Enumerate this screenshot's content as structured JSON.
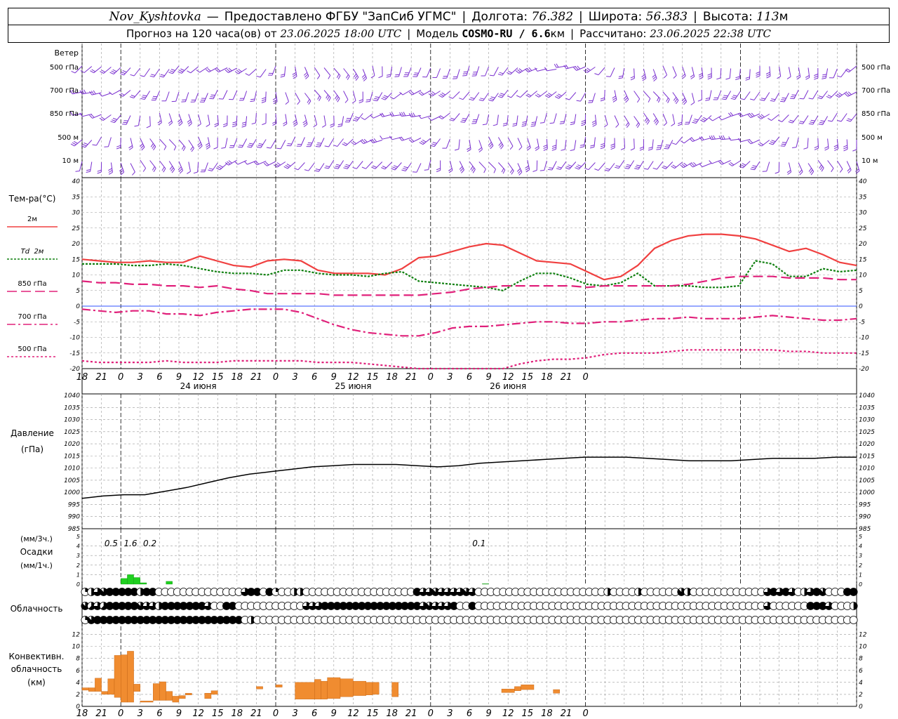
{
  "header": {
    "station": "Nov_Kyshtovka",
    "dash": "—",
    "provider": "Предоставлено ФГБУ \"ЗапСиб УГМС\"",
    "lon_label": "Долгота:",
    "lon": "76.382",
    "lat_label": "Широта:",
    "lat": "56.383",
    "alt_label": "Высота:",
    "alt": "113",
    "alt_unit": "м",
    "forecast_label": "Прогноз на 120 часа(ов) от",
    "forecast_from": "23.06.2025 18:00 UTC",
    "model_label": "Модель",
    "model": "COSMO-RU / 6.6",
    "model_unit": "км",
    "calc_label": "Рассчитано:",
    "calc_time": "23.06.2025 22:38 UTC"
  },
  "labels": {
    "wind": "Ветер",
    "levels": [
      "500 гПа",
      "700 гПа",
      "850 гПа",
      "500 м",
      "10 м"
    ],
    "temp_title": "Тем-ра(°C)",
    "temp_legend": [
      {
        "label": "2м",
        "color": "#f04040"
      },
      {
        "label": "Td  2м",
        "color": "#108010"
      },
      {
        "label": "850 гПа",
        "color": "#e0207a"
      },
      {
        "label": "700 гПа",
        "color": "#e0207a"
      },
      {
        "label": "500 гПа",
        "color": "#e0207a"
      }
    ],
    "pressure_title_1": "Давление",
    "pressure_title_2": "(гПа)",
    "precip_title_1": "(мм/3ч.)",
    "precip_title_2": "Осадки",
    "precip_title_3": "(мм/1ч.)",
    "cloud_title": "Облачность",
    "conv_title_1": "Конвективн.",
    "conv_title_2": "облачность",
    "conv_title_3": "(км)"
  },
  "chart_data": {
    "type": "line",
    "time_axis": {
      "hour_labels": [
        "18",
        "21",
        "0",
        "3",
        "6",
        "9",
        "12",
        "15",
        "18",
        "21",
        "0",
        "3",
        "6",
        "9",
        "12",
        "15",
        "18",
        "21",
        "0",
        "3",
        "6",
        "9",
        "12",
        "15",
        "18",
        "21",
        "0"
      ],
      "day_labels": [
        "24 июня",
        "25 июня",
        "26 июня"
      ]
    },
    "temperature": {
      "ylim": [
        -20,
        40
      ],
      "ticks": [
        -20,
        -15,
        -10,
        -5,
        0,
        5,
        10,
        15,
        20,
        25,
        30,
        35,
        40
      ],
      "hours": [
        0,
        3,
        6,
        9,
        12,
        15,
        18,
        21,
        24,
        27,
        30,
        33,
        36,
        39,
        42,
        45,
        48,
        51,
        54,
        57,
        60,
        63,
        66,
        69,
        72,
        75,
        78,
        81,
        84,
        87,
        90,
        93,
        96,
        99,
        102,
        105,
        108,
        111,
        114,
        117,
        120
      ],
      "series": [
        {
          "name": "2м",
          "color": "#f04040",
          "dash": "",
          "values": [
            15,
            14.5,
            14,
            14,
            14.5,
            14,
            14,
            16,
            14.5,
            13,
            12.5,
            14.5,
            15,
            14.5,
            11.5,
            10.5,
            10.5,
            10.5,
            10,
            12,
            15.5,
            16,
            17.5,
            19,
            20,
            19.5,
            17,
            14.5,
            14,
            13.5,
            11,
            8.5,
            9.5,
            13,
            18.5,
            21,
            22.5,
            23,
            23,
            22.5,
            21.5,
            19.5,
            17.5,
            18.5,
            16.5,
            14,
            13
          ]
        },
        {
          "name": "Td  2м",
          "color": "#108010",
          "dash": "3,2",
          "values": [
            13.5,
            13.5,
            13.5,
            13,
            13,
            13.5,
            13,
            12,
            11,
            10.5,
            10.5,
            10,
            11.5,
            11.5,
            10.5,
            10,
            10,
            9.5,
            10.5,
            11,
            8,
            7.5,
            7,
            6.5,
            6,
            5,
            8,
            10.5,
            10.5,
            9,
            7,
            6.5,
            7.5,
            10.5,
            6.5,
            6.5,
            6.5,
            6,
            6,
            6.5,
            14.5,
            13.5,
            9.5,
            9.5,
            12,
            11,
            11.5
          ]
        },
        {
          "name": "850 гПа",
          "color": "#e0207a",
          "dash": "14,6",
          "values": [
            8,
            7.5,
            7.5,
            7,
            7,
            6.5,
            6.5,
            6,
            6.5,
            5.5,
            5,
            4,
            4,
            4,
            4,
            3.5,
            3.5,
            3.5,
            3.5,
            3.5,
            3.5,
            4,
            4.5,
            5.5,
            6,
            6.5,
            6.5,
            6.5,
            6.5,
            6.5,
            6,
            6.5,
            6.5,
            6.5,
            6.5,
            6.5,
            7,
            8,
            9,
            9.5,
            9.5,
            9.5,
            9,
            9,
            9,
            8.5,
            8.5
          ]
        },
        {
          "name": "700 гПа",
          "color": "#e0207a",
          "dash": "12,4,3,4",
          "values": [
            -1,
            -1.5,
            -2,
            -1.5,
            -1.5,
            -2.5,
            -2.5,
            -3,
            -2,
            -1.5,
            -1,
            -1,
            -1,
            -2,
            -4,
            -6,
            -7.5,
            -8.5,
            -9,
            -9.5,
            -9.5,
            -8.5,
            -7,
            -6.5,
            -6.5,
            -6,
            -5.5,
            -5,
            -5,
            -5.5,
            -5.5,
            -5,
            -5,
            -4.5,
            -4,
            -4,
            -3.5,
            -4,
            -4,
            -4,
            -3.5,
            -3,
            -3.5,
            -4,
            -4.5,
            -4.5,
            -4
          ]
        },
        {
          "name": "500 гПа",
          "color": "#e0207a",
          "dash": "3,3",
          "values": [
            -17.5,
            -18,
            -18,
            -18,
            -18,
            -17.5,
            -18,
            -18,
            -18,
            -17.5,
            -17.5,
            -17.5,
            -17.5,
            -17.5,
            -18,
            -18,
            -18,
            -18.5,
            -19,
            -19.5,
            -20,
            -20,
            -20,
            -20,
            -20,
            -20,
            -18.5,
            -17.5,
            -17,
            -17,
            -16.5,
            -15.5,
            -15,
            -15,
            -15,
            -14.5,
            -14,
            -14,
            -14,
            -14,
            -14,
            -14,
            -14.5,
            -14.5,
            -15,
            -15,
            -15
          ]
        }
      ]
    },
    "pressure": {
      "ylim": [
        985,
        1040
      ],
      "ticks": [
        985,
        990,
        995,
        1000,
        1005,
        1010,
        1015,
        1020,
        1025,
        1030,
        1035,
        1040
      ],
      "values": [
        997.5,
        998.5,
        999,
        999,
        1000.5,
        1002,
        1004,
        1006,
        1007.5,
        1008.5,
        1009.5,
        1010.5,
        1011,
        1011.5,
        1011.5,
        1011.5,
        1011,
        1010.5,
        1011,
        1012,
        1012.5,
        1013,
        1013.5,
        1014,
        1014.5,
        1014.5,
        1014.5,
        1014,
        1013.5,
        1013,
        1013,
        1013,
        1013.5,
        1014,
        1014,
        1014,
        1014.5,
        1014.5
      ]
    },
    "precipitation": {
      "ylim": [
        0,
        5
      ],
      "ticks": [
        0,
        1,
        2,
        3,
        4,
        5
      ],
      "labels": [
        {
          "hour": 6,
          "text": "0.5"
        },
        {
          "hour": 9,
          "text": "1.6"
        },
        {
          "hour": 12,
          "text": "0.2"
        },
        {
          "hour": 63,
          "text": "0.1"
        }
      ],
      "hourly": [
        {
          "hour": 6,
          "value": 0.6
        },
        {
          "hour": 7,
          "value": 1.0
        },
        {
          "hour": 8,
          "value": 0.7
        },
        {
          "hour": 9,
          "value": 0.15
        },
        {
          "hour": 13,
          "value": 0.3
        },
        {
          "hour": 62,
          "value": 0.05
        }
      ]
    },
    "cloud_cover": {
      "scale": "octas 0-8",
      "rows": [
        [
          2,
          4,
          6,
          7,
          8,
          8,
          8,
          8,
          8,
          4,
          8,
          8,
          0,
          0,
          0,
          0,
          0,
          0,
          0,
          0,
          0,
          0,
          0,
          0,
          0,
          0,
          6,
          8,
          8,
          0,
          8,
          2,
          0,
          0,
          4,
          4,
          0,
          0,
          0,
          0,
          0,
          0,
          0,
          0,
          0,
          0,
          0,
          0,
          0,
          0,
          0,
          0,
          0,
          0,
          8,
          6,
          6,
          7,
          6,
          6,
          6,
          6,
          7,
          6,
          0,
          0,
          0,
          0,
          0,
          0,
          0,
          0,
          0,
          0,
          0,
          0,
          0,
          0,
          0,
          0,
          0,
          0,
          0,
          0,
          0,
          4,
          0,
          0,
          0,
          0,
          4,
          0,
          0,
          0,
          0,
          0,
          0,
          7,
          4,
          0,
          0,
          0,
          0,
          0,
          0,
          0,
          0,
          0,
          0,
          0,
          0,
          6,
          8,
          6,
          8,
          6,
          0,
          4,
          6,
          8,
          7,
          0,
          0,
          0,
          8,
          8
        ],
        [
          7,
          5,
          6,
          5,
          8,
          8,
          8,
          8,
          8,
          7,
          6,
          6,
          4,
          8,
          8,
          8,
          8,
          8,
          8,
          8,
          6,
          0,
          0,
          8,
          8,
          0,
          0,
          0,
          0,
          0,
          0,
          0,
          0,
          0,
          0,
          0,
          6,
          6,
          6,
          8,
          8,
          8,
          8,
          8,
          8,
          8,
          8,
          8,
          8,
          8,
          8,
          8,
          8,
          8,
          8,
          6,
          7,
          6,
          6,
          6,
          8,
          0,
          0,
          8,
          0,
          0,
          0,
          0,
          0,
          0,
          0,
          0,
          0,
          0,
          0,
          0,
          0,
          0,
          0,
          0,
          0,
          0,
          0,
          0,
          0,
          0,
          0,
          0,
          0,
          0,
          0,
          0,
          0,
          0,
          0,
          0,
          0,
          0,
          0,
          0,
          0,
          0,
          0,
          0,
          0,
          0,
          0,
          0,
          0,
          0,
          0,
          6,
          0,
          0,
          0,
          0,
          0,
          0,
          8,
          8,
          8,
          6,
          0,
          0,
          0,
          4
        ],
        [
          2,
          7,
          8,
          8,
          8,
          8,
          8,
          8,
          8,
          8,
          8,
          8,
          8,
          8,
          8,
          8,
          8,
          8,
          8,
          8,
          8,
          8,
          8,
          8,
          8,
          8,
          0,
          4,
          0,
          0,
          0,
          0,
          0,
          0,
          0,
          0,
          0,
          0,
          0,
          0,
          0,
          0,
          0,
          0,
          0,
          0,
          0,
          0,
          0,
          0,
          0,
          0,
          0,
          0,
          0,
          0,
          0,
          0,
          0,
          0,
          0,
          0,
          0,
          0,
          0,
          0,
          0,
          0,
          0,
          0,
          0,
          0,
          0,
          0,
          0,
          0,
          0,
          0,
          0,
          0,
          0,
          0,
          0,
          0,
          0,
          0,
          0,
          0,
          0,
          0,
          0,
          0,
          0,
          0,
          0,
          0,
          0,
          0,
          0,
          0,
          0,
          0,
          0,
          0,
          0,
          0,
          0,
          0,
          0,
          0,
          0,
          0,
          0,
          0,
          0,
          0,
          0,
          0,
          0,
          0,
          0,
          0,
          0,
          0,
          0,
          0
        ]
      ]
    },
    "convective_cloud": {
      "ylim": [
        0,
        13
      ],
      "ticks": [
        0,
        2,
        4,
        6,
        8,
        10,
        12
      ],
      "units": "km",
      "bars": [
        {
          "h0": 0,
          "h1": 1,
          "base": 2.7,
          "top": 3.1
        },
        {
          "h0": 1,
          "h1": 2,
          "base": 2.5,
          "top": 3.1
        },
        {
          "h0": 2,
          "h1": 3,
          "base": 2.5,
          "top": 4.7
        },
        {
          "h0": 3,
          "h1": 4,
          "base": 2,
          "top": 2.5
        },
        {
          "h0": 4,
          "h1": 5,
          "base": 2,
          "top": 4.6
        },
        {
          "h0": 5,
          "h1": 6,
          "base": 1.5,
          "top": 8.5
        },
        {
          "h0": 6,
          "h1": 7,
          "base": 0.7,
          "top": 8.6
        },
        {
          "h0": 7,
          "h1": 8,
          "base": 0.7,
          "top": 9.2
        },
        {
          "h0": 8,
          "h1": 9,
          "base": 2.5,
          "top": 3.7
        },
        {
          "h0": 9,
          "h1": 11,
          "base": 0.7,
          "top": 0.9
        },
        {
          "h0": 11,
          "h1": 12,
          "base": 1,
          "top": 3.8
        },
        {
          "h0": 12,
          "h1": 13,
          "base": 1,
          "top": 4.1
        },
        {
          "h0": 13,
          "h1": 14,
          "base": 1,
          "top": 2.5
        },
        {
          "h0": 14,
          "h1": 15,
          "base": 0.7,
          "top": 1.7
        },
        {
          "h0": 15,
          "h1": 16,
          "base": 1.3,
          "top": 1.8
        },
        {
          "h0": 16,
          "h1": 17,
          "base": 1.9,
          "top": 2.2
        },
        {
          "h0": 19,
          "h1": 20,
          "base": 1.3,
          "top": 2.2
        },
        {
          "h0": 20,
          "h1": 21,
          "base": 2,
          "top": 2.6
        },
        {
          "h0": 27,
          "h1": 28,
          "base": 2.9,
          "top": 3.3
        },
        {
          "h0": 30,
          "h1": 31,
          "base": 3.2,
          "top": 3.6
        },
        {
          "h0": 33,
          "h1": 36,
          "base": 1.2,
          "top": 4
        },
        {
          "h0": 36,
          "h1": 37,
          "base": 1.2,
          "top": 4.5
        },
        {
          "h0": 37,
          "h1": 38,
          "base": 1.2,
          "top": 4.2
        },
        {
          "h0": 38,
          "h1": 40,
          "base": 1.3,
          "top": 4.8
        },
        {
          "h0": 40,
          "h1": 42,
          "base": 1.6,
          "top": 4.6
        },
        {
          "h0": 42,
          "h1": 44,
          "base": 1.8,
          "top": 4.2
        },
        {
          "h0": 44,
          "h1": 45,
          "base": 1.9,
          "top": 4.0
        },
        {
          "h0": 45,
          "h1": 46,
          "base": 2,
          "top": 4
        },
        {
          "h0": 48,
          "h1": 49,
          "base": 1.6,
          "top": 4
        },
        {
          "h0": 65,
          "h1": 67,
          "base": 2.3,
          "top": 2.9
        },
        {
          "h0": 67,
          "h1": 68,
          "base": 2.6,
          "top": 3.3
        },
        {
          "h0": 68,
          "h1": 70,
          "base": 2.8,
          "top": 3.6
        },
        {
          "h0": 73,
          "h1": 74,
          "base": 2.2,
          "top": 2.8
        }
      ]
    }
  }
}
